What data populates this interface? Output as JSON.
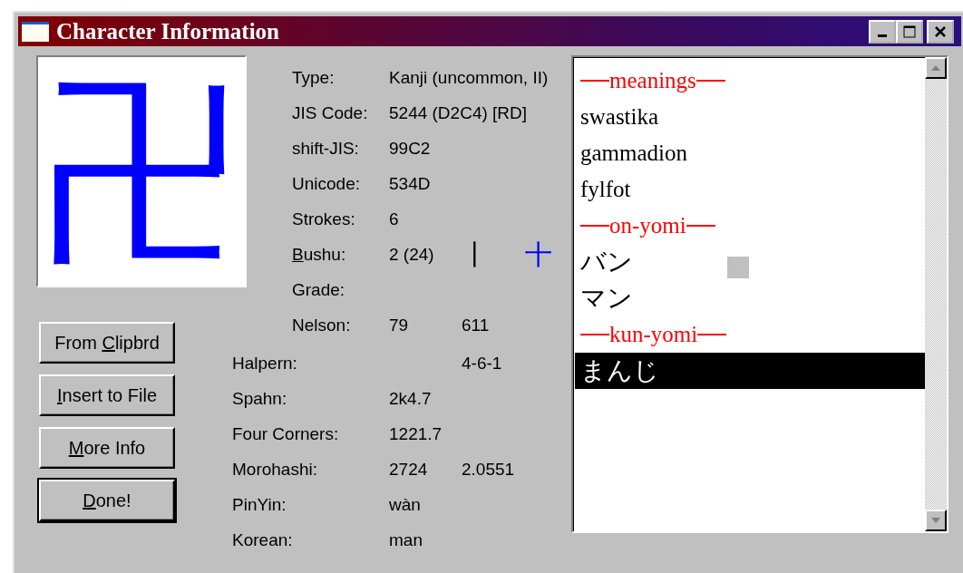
{
  "window": {
    "title": "Character Information"
  },
  "character": "卍",
  "info": [
    {
      "label": {
        "rest": "Type:"
      },
      "value": "Kanji (uncommon, II)"
    },
    {
      "label": {
        "rest": "JIS Code:"
      },
      "value": "5244 (D2C4) [RD]"
    },
    {
      "label": {
        "rest": "shift-JIS:"
      },
      "value": "99C2"
    },
    {
      "label": {
        "rest": "Unicode:"
      },
      "value": "534D"
    },
    {
      "label": {
        "rest": "Strokes:"
      },
      "value": "6"
    },
    {
      "label": {
        "key": "B",
        "rest": "ushu:"
      },
      "value": "2 (24)",
      "radicals": [
        {
          "glyph": "丨",
          "color": "#000000"
        },
        {
          "glyph": "十",
          "color": "#0000ff"
        }
      ]
    },
    {
      "label": {
        "rest": "Grade:"
      }
    },
    {
      "label": {
        "rest": "Nelson:"
      },
      "value": "79",
      "value_2": "611"
    }
  ],
  "more_info": [
    {
      "label": "Halpern:",
      "value_2": "4-6-1"
    },
    {
      "label": "Spahn:",
      "value": "2k4.7"
    },
    {
      "label": "Four Corners:",
      "value": "1221.7"
    },
    {
      "label": "Morohashi:",
      "value": "2724",
      "value_2": "2.0551"
    },
    {
      "label": "PinYin:",
      "value": "wàn"
    },
    {
      "label": "Korean:",
      "value": "man"
    }
  ],
  "buttons": [
    {
      "label": {
        "before": "From ",
        "key": "C",
        "rest": "lipbrd"
      },
      "default": false
    },
    {
      "label": {
        "key": "I",
        "rest": "nsert to File"
      },
      "default": false
    },
    {
      "label": {
        "key": "M",
        "rest": "ore Info"
      },
      "default": false
    },
    {
      "label": {
        "key": "D",
        "rest": "one!"
      },
      "default": true
    }
  ],
  "readings": [
    {
      "kind": "header",
      "text": "meanings",
      "selected": false
    },
    {
      "kind": "entry",
      "text": "swastika",
      "selected": false
    },
    {
      "kind": "entry",
      "text": "gammadion",
      "selected": false
    },
    {
      "kind": "entry",
      "text": "fylfot",
      "selected": false
    },
    {
      "kind": "header",
      "text": "on-yomi",
      "selected": false
    },
    {
      "kind": "entry",
      "text": "バン",
      "selected": false
    },
    {
      "kind": "entry",
      "text": "マン",
      "selected": false
    },
    {
      "kind": "header",
      "text": "kun-yomi",
      "selected": false
    },
    {
      "kind": "entry",
      "text": "まんじ",
      "selected": true
    }
  ]
}
